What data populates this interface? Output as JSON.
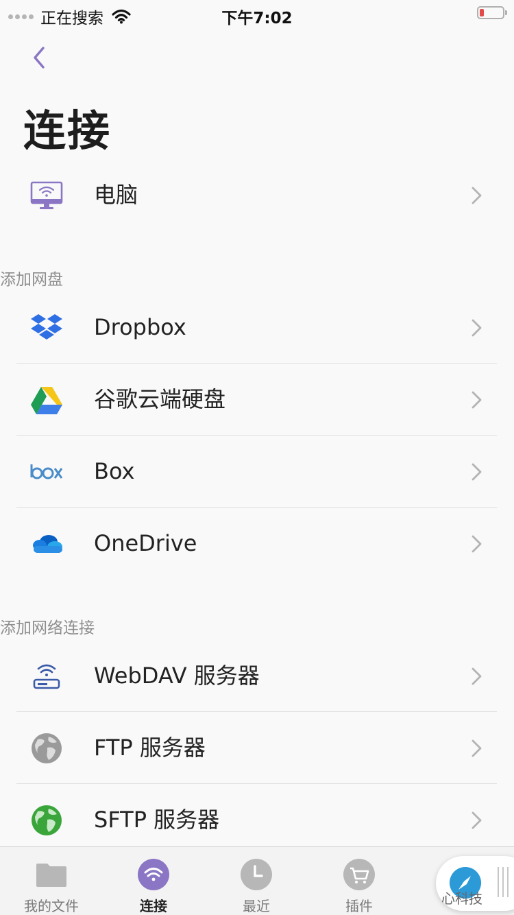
{
  "status_bar": {
    "carrier": "正在搜索",
    "time": "下午7:02"
  },
  "nav": {
    "back_icon": "chevron-left-icon",
    "title": "连接"
  },
  "computer": {
    "label": "电脑",
    "icon": "computer-icon"
  },
  "cloud_section": {
    "header": "添加网盘",
    "items": [
      {
        "label": "Dropbox",
        "icon": "dropbox-icon"
      },
      {
        "label": "谷歌云端硬盘",
        "icon": "google-drive-icon"
      },
      {
        "label": "Box",
        "icon": "box-icon"
      },
      {
        "label": "OneDrive",
        "icon": "onedrive-icon"
      }
    ]
  },
  "network_section": {
    "header": "添加网络连接",
    "items": [
      {
        "label": "WebDAV 服务器",
        "icon": "webdav-router-icon"
      },
      {
        "label": "FTP 服务器",
        "icon": "globe-gray-icon"
      },
      {
        "label": "SFTP 服务器",
        "icon": "globe-green-icon"
      }
    ]
  },
  "tab_bar": {
    "tabs": [
      {
        "label": "我的文件",
        "icon": "folder-icon",
        "active": false
      },
      {
        "label": "连接",
        "icon": "wifi-icon",
        "active": true
      },
      {
        "label": "最近",
        "icon": "clock-icon",
        "active": false
      },
      {
        "label": "插件",
        "icon": "cart-icon",
        "active": false
      }
    ]
  },
  "watermark": "心科技",
  "colors": {
    "accent": "#8a76c4",
    "background": "#f9f9f9",
    "divider": "#e0e0e0",
    "section_header": "#8e8e8e",
    "chevron": "#b3b3b3"
  }
}
